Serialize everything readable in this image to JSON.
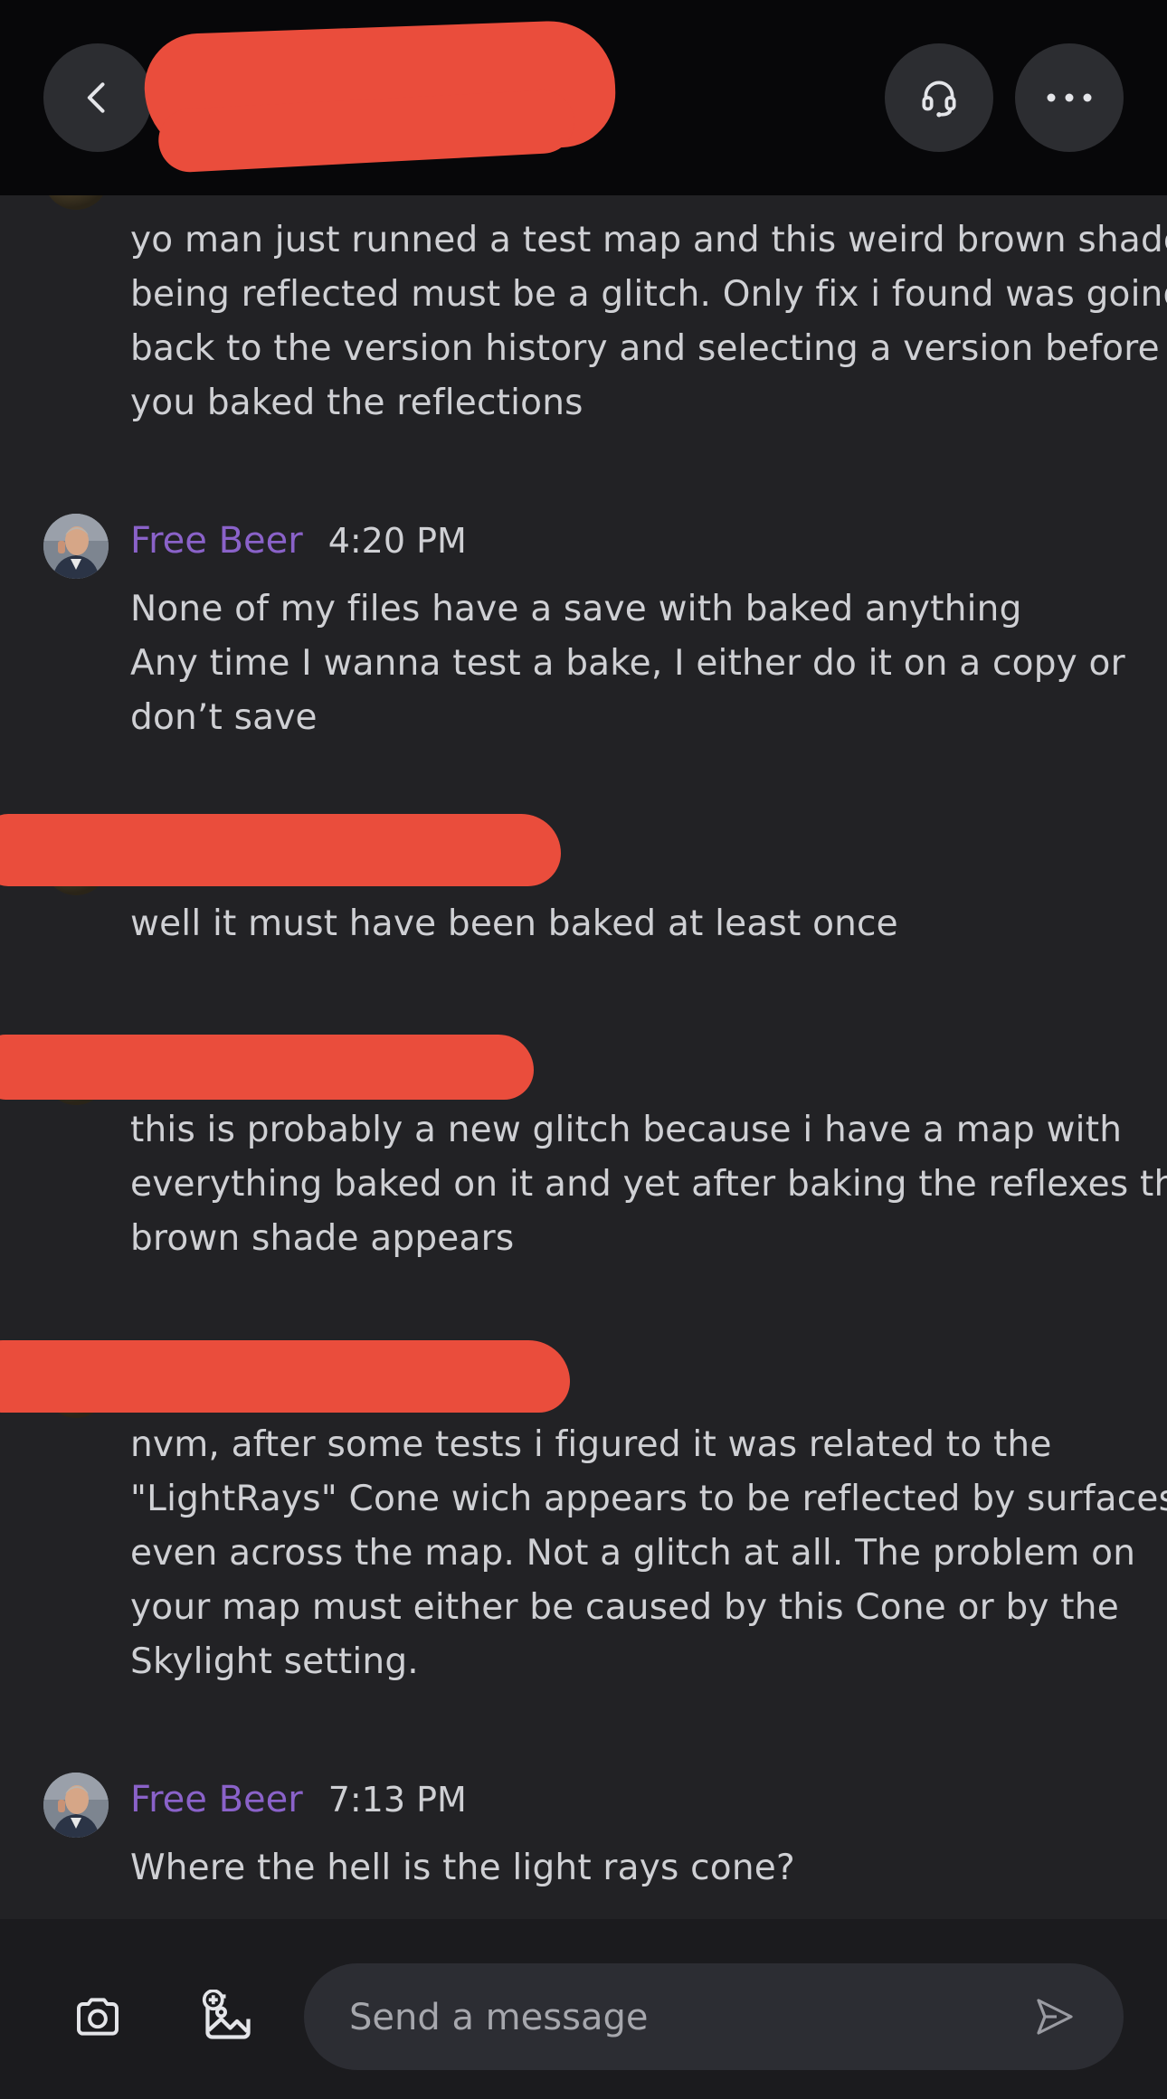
{
  "header": {
    "back_icon": "chevron-left-icon",
    "support_icon": "headset-icon",
    "more_icon": "more-horizontal-icon"
  },
  "messages": [
    {
      "lines": [
        "yo man just runned a test map and this weird brown shade",
        "being reflected must be a glitch. Only fix i found was going",
        "back to the version history and selecting a version before",
        "you baked the reflections"
      ]
    },
    {
      "username": "Free Beer",
      "time": "4:20 PM",
      "lines": [
        "None of my files have a save with baked anything",
        "Any time I wanna test a bake, I either do it on a copy or",
        "don’t save"
      ]
    },
    {
      "lines": [
        "well it must have been baked at least once"
      ]
    },
    {
      "lines": [
        "this is probably a new glitch because i have a map with",
        "everything baked on it and yet after baking the reflexes the",
        "brown shade appears"
      ]
    },
    {
      "lines": [
        "nvm, after some tests i figured it was related to the",
        "\"LightRays\" Cone wich appears to be reflected by surfaces",
        "even across the map. Not a glitch at all. The problem on",
        "your map must either be caused by this Cone or by the",
        "Skylight setting."
      ]
    },
    {
      "username": "Free Beer",
      "time": "7:13 PM",
      "lines": [
        "Where the hell is the light rays cone?"
      ]
    }
  ],
  "composer": {
    "camera_icon": "camera-icon",
    "gallery_icon": "image-add-icon",
    "placeholder": "Send a message",
    "value": "",
    "send_icon": "send-icon"
  },
  "colors": {
    "background": "#222225",
    "header": "#070709",
    "username": "#8a62c9",
    "text": "#cfd0d4",
    "redaction": "#ea4d3c"
  }
}
